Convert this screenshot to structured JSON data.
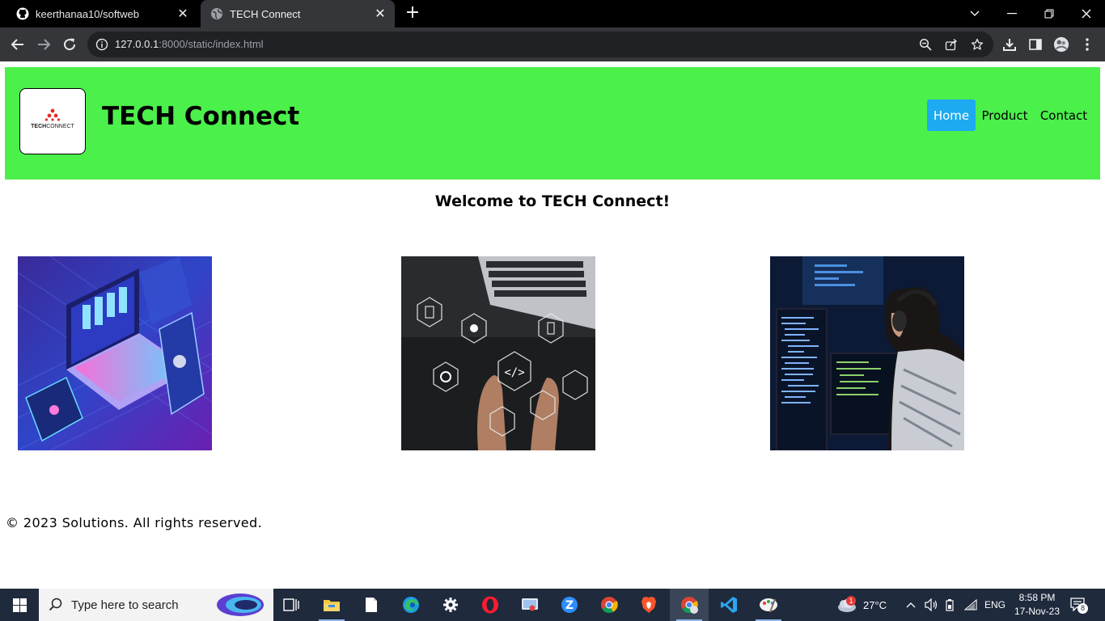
{
  "browser": {
    "tabs": [
      {
        "title": "keerthanaa10/softweb",
        "icon": "github-icon"
      },
      {
        "title": "TECH Connect",
        "icon": "globe-icon",
        "active": true
      }
    ],
    "new_tab_label": "+",
    "url_host": "127.0.0.1",
    "url_rest": ":8000/static/index.html"
  },
  "page": {
    "logo_text_bold": "TECH",
    "logo_text_rest": "CONNECT",
    "title": "TECH Connect",
    "nav": [
      {
        "label": "Home",
        "active": true
      },
      {
        "label": "Product"
      },
      {
        "label": "Contact"
      }
    ],
    "welcome": "Welcome to TECH Connect!",
    "footer": "© 2023 Solutions. All rights reserved.",
    "accent_color": "#4bf04b",
    "active_nav_color": "#1eaaf1"
  },
  "taskbar": {
    "search_placeholder": "Type here to search",
    "apps": [
      "task-view",
      "file-explorer",
      "notepad",
      "edge",
      "settings",
      "opera",
      "snipping-tool",
      "zoom",
      "chrome",
      "brave",
      "chrome-profile",
      "vscode",
      "paint"
    ],
    "weather": "27°C",
    "weather_badge": "1",
    "language": "ENG",
    "time": "8:58 PM",
    "date": "17-Nov-23",
    "notification_count": "8"
  }
}
